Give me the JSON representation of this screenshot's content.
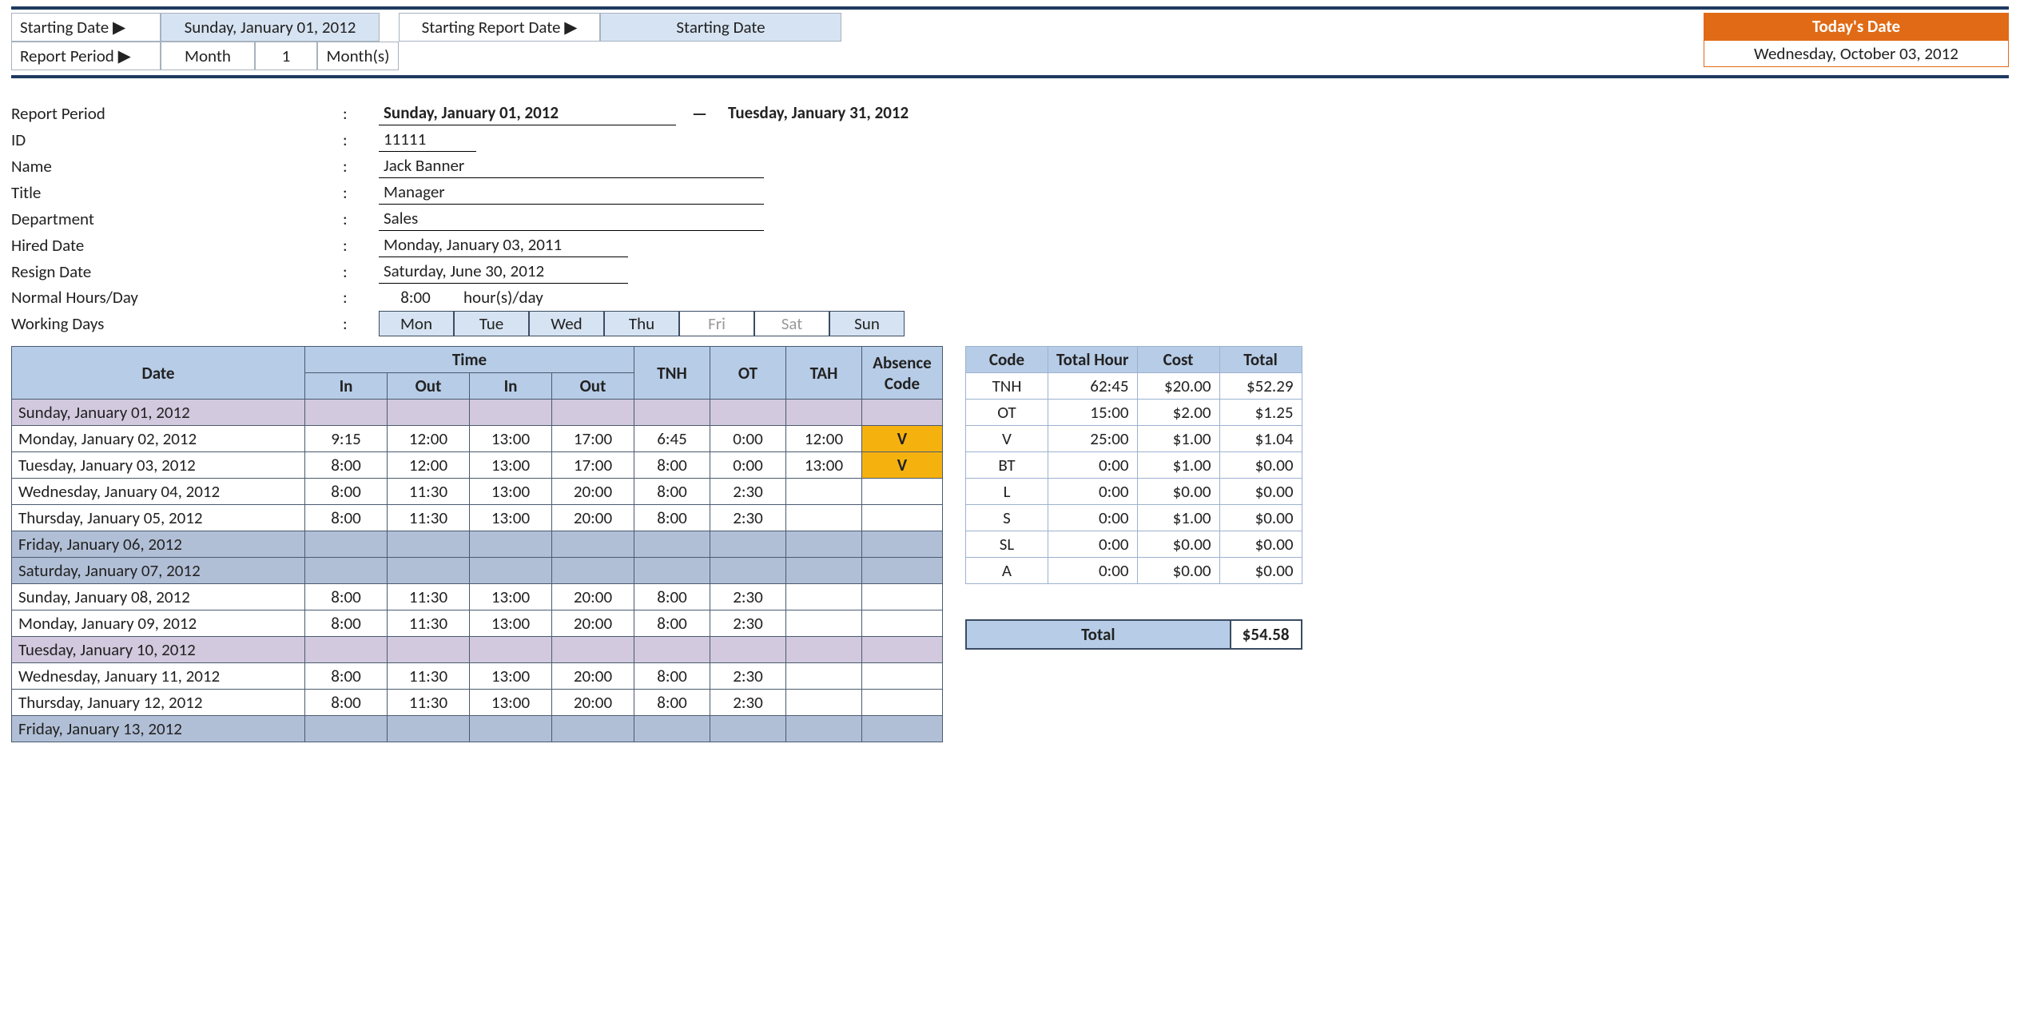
{
  "top": {
    "starting_date_label": "Starting Date ▶",
    "starting_date_value": "Sunday, January 01, 2012",
    "report_period_label": "Report Period ▶",
    "report_period_month": "Month",
    "report_period_num": "1",
    "report_period_unit": "Month(s)",
    "starting_report_date_label": "Starting Report Date ▶",
    "starting_report_date_value": "Starting Date",
    "today_label": "Today's Date",
    "today_value": "Wednesday, October 03, 2012"
  },
  "info": {
    "report_period_label": "Report Period",
    "report_period_from": "Sunday, January 01, 2012",
    "report_period_to": "Tuesday, January 31, 2012",
    "id_label": "ID",
    "id_value": "11111",
    "name_label": "Name",
    "name_value": "Jack Banner",
    "title_label": "Title",
    "title_value": "Manager",
    "department_label": "Department",
    "department_value": "Sales",
    "hired_label": "Hired Date",
    "hired_value": "Monday, January 03, 2011",
    "resign_label": "Resign Date",
    "resign_value": "Saturday, June 30, 2012",
    "normal_label": "Normal Hours/Day",
    "normal_value": "8:00",
    "normal_unit": "hour(s)/day",
    "working_label": "Working Days",
    "days": [
      "Mon",
      "Tue",
      "Wed",
      "Thu",
      "Fri",
      "Sat",
      "Sun"
    ]
  },
  "main": {
    "headers": {
      "date": "Date",
      "time": "Time",
      "in": "In",
      "out": "Out",
      "tnh": "TNH",
      "ot": "OT",
      "tah": "TAH",
      "absence": "Absence Code"
    },
    "rows": [
      {
        "date": "Sunday, January 01, 2012",
        "cls": "row-purple"
      },
      {
        "date": "Monday, January 02, 2012",
        "in1": "9:15",
        "out1": "12:00",
        "in2": "13:00",
        "out2": "17:00",
        "tnh": "6:45",
        "ot": "0:00",
        "tah": "12:00",
        "abs": "V"
      },
      {
        "date": "Tuesday, January 03, 2012",
        "in1": "8:00",
        "out1": "12:00",
        "in2": "13:00",
        "out2": "17:00",
        "tnh": "8:00",
        "ot": "0:00",
        "tah": "13:00",
        "abs": "V"
      },
      {
        "date": "Wednesday, January 04, 2012",
        "in1": "8:00",
        "out1": "11:30",
        "in2": "13:00",
        "out2": "20:00",
        "tnh": "8:00",
        "ot": "2:30"
      },
      {
        "date": "Thursday, January 05, 2012",
        "in1": "8:00",
        "out1": "11:30",
        "in2": "13:00",
        "out2": "20:00",
        "tnh": "8:00",
        "ot": "2:30"
      },
      {
        "date": "Friday, January 06, 2012",
        "cls": "row-blue"
      },
      {
        "date": "Saturday, January 07, 2012",
        "cls": "row-blue"
      },
      {
        "date": "Sunday, January 08, 2012",
        "in1": "8:00",
        "out1": "11:30",
        "in2": "13:00",
        "out2": "20:00",
        "tnh": "8:00",
        "ot": "2:30"
      },
      {
        "date": "Monday, January 09, 2012",
        "in1": "8:00",
        "out1": "11:30",
        "in2": "13:00",
        "out2": "20:00",
        "tnh": "8:00",
        "ot": "2:30"
      },
      {
        "date": "Tuesday, January 10, 2012",
        "cls": "row-purple"
      },
      {
        "date": "Wednesday, January 11, 2012",
        "in1": "8:00",
        "out1": "11:30",
        "in2": "13:00",
        "out2": "20:00",
        "tnh": "8:00",
        "ot": "2:30"
      },
      {
        "date": "Thursday, January 12, 2012",
        "in1": "8:00",
        "out1": "11:30",
        "in2": "13:00",
        "out2": "20:00",
        "tnh": "8:00",
        "ot": "2:30"
      },
      {
        "date": "Friday, January 13, 2012",
        "cls": "row-blue"
      }
    ]
  },
  "summary": {
    "headers": {
      "code": "Code",
      "hour": "Total Hour",
      "cost": "Cost",
      "total": "Total"
    },
    "rows": [
      {
        "code": "TNH",
        "hour": "62:45",
        "cost": "$20.00",
        "total": "$52.29"
      },
      {
        "code": "OT",
        "hour": "15:00",
        "cost": "$2.00",
        "total": "$1.25"
      },
      {
        "code": "V",
        "hour": "25:00",
        "cost": "$1.00",
        "total": "$1.04"
      },
      {
        "code": "BT",
        "hour": "0:00",
        "cost": "$1.00",
        "total": "$0.00"
      },
      {
        "code": "L",
        "hour": "0:00",
        "cost": "$0.00",
        "total": "$0.00"
      },
      {
        "code": "S",
        "hour": "0:00",
        "cost": "$1.00",
        "total": "$0.00"
      },
      {
        "code": "SL",
        "hour": "0:00",
        "cost": "$0.00",
        "total": "$0.00"
      },
      {
        "code": "A",
        "hour": "0:00",
        "cost": "$0.00",
        "total": "$0.00"
      }
    ],
    "grand_label": "Total",
    "grand_value": "$54.58"
  }
}
